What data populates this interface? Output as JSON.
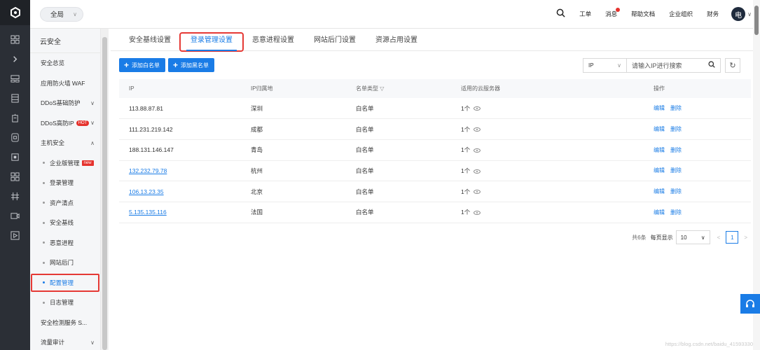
{
  "topbar": {
    "scope_label": "全局",
    "nav": [
      "工单",
      "消息",
      "帮助文档",
      "企业组织",
      "财务"
    ],
    "avatar_text": "电"
  },
  "sidebar": {
    "title": "云安全",
    "items": [
      {
        "label": "安全总览"
      },
      {
        "label": "应用防火墙 WAF"
      },
      {
        "label": "DDoS基础防护"
      },
      {
        "label": "DDoS高防IP",
        "badge": "HOT"
      },
      {
        "label": "主机安全"
      }
    ],
    "sub_items": [
      {
        "label": "企业版管理",
        "badge": "new"
      },
      {
        "label": "登录管理"
      },
      {
        "label": "资产清点"
      },
      {
        "label": "安全基线"
      },
      {
        "label": "恶意进程"
      },
      {
        "label": "网站后门"
      },
      {
        "label": "配置管理"
      },
      {
        "label": "日志管理"
      }
    ],
    "bottom_items": [
      {
        "label": "安全检测服务 S..."
      },
      {
        "label": "流量审计"
      }
    ]
  },
  "tabs": [
    "安全基线设置",
    "登录管理设置",
    "恶意进程设置",
    "网站后门设置",
    "资源占用设置"
  ],
  "toolbar": {
    "add_whitelist": "添加白名单",
    "add_blacklist": "添加黑名单",
    "filter_value": "IP",
    "search_placeholder": "请输入IP进行搜索"
  },
  "table": {
    "headers": [
      "IP",
      "IP归属地",
      "名单类型",
      "适用的云服务器",
      "操作"
    ],
    "rows": [
      {
        "ip": "113.88.87.81",
        "location": "深圳",
        "type": "白名单",
        "servers": "1个",
        "link": false
      },
      {
        "ip": "111.231.219.142",
        "location": "成都",
        "type": "白名单",
        "servers": "1个",
        "link": false
      },
      {
        "ip": "188.131.146.147",
        "location": "青岛",
        "type": "白名单",
        "servers": "1个",
        "link": false
      },
      {
        "ip": "132.232.79.78",
        "location": "杭州",
        "type": "白名单",
        "servers": "1个",
        "link": true
      },
      {
        "ip": "106.13.23.35",
        "location": "北京",
        "type": "白名单",
        "servers": "1个",
        "link": true
      },
      {
        "ip": "5.135.135.116",
        "location": "法国",
        "type": "白名单",
        "servers": "1个",
        "link": true
      }
    ],
    "edit_label": "编辑",
    "delete_label": "删除"
  },
  "pagination": {
    "total": "共6条",
    "per_page_label": "每页显示",
    "per_page_value": "10",
    "current_page": "1"
  },
  "watermark": "https://blog.csdn.net/baidu_41593330"
}
